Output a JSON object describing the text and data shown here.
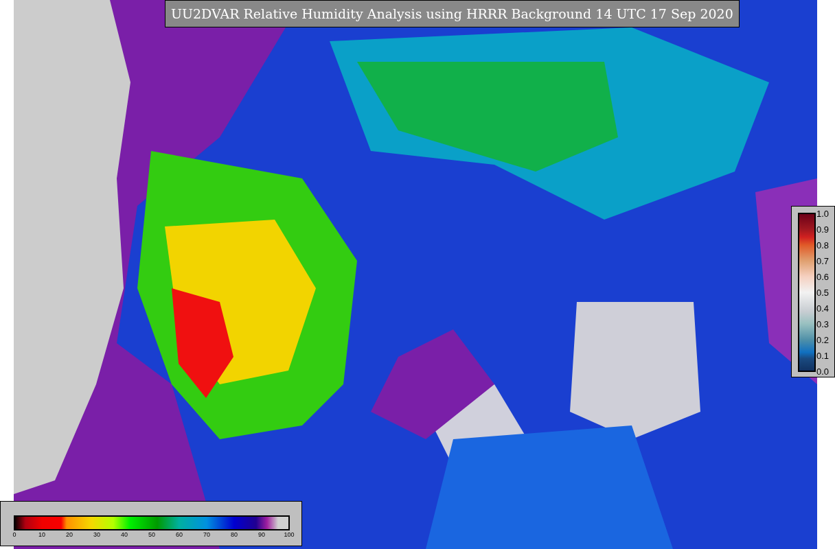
{
  "title": "UU2DVAR Relative Humidity Analysis using HRRR Background 14 UTC 17 Sep 2020",
  "analysis_colorbar": {
    "ticks": [
      "0",
      "10",
      "20",
      "30",
      "40",
      "50",
      "60",
      "70",
      "80",
      "90",
      "100"
    ]
  },
  "observation_colorbar": {
    "ticks": [
      "1.0",
      "0.9",
      "0.8",
      "0.7",
      "0.6",
      "0.5",
      "0.4",
      "0.3",
      "0.2",
      "0.1",
      "0.0"
    ]
  }
}
